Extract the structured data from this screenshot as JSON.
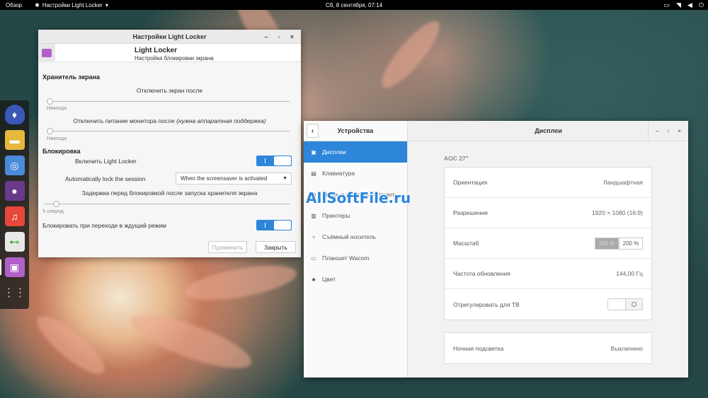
{
  "topbar": {
    "overview": "Обзор",
    "app_name": "Настройки Light Locker",
    "clock": "Сб, 8 сентября, 07:14",
    "tray_icons": [
      "display-icon",
      "wifi-icon",
      "volume-icon",
      "power-icon"
    ]
  },
  "dock": {
    "items": [
      "diamond-app-icon",
      "files-icon",
      "chromium-icon",
      "pidgin-icon",
      "music-icon",
      "settings-toggle-icon",
      "light-locker-icon",
      "app-grid-icon"
    ]
  },
  "light_locker": {
    "window_title": "Настройки Light Locker",
    "header_title": "Light Locker",
    "header_subtitle": "Настройка блокировки экрана",
    "screensaver_section": "Хранитель экрана",
    "screen_off_label": "Отключить экран после",
    "screen_off_value": "Никогда",
    "monitor_off_label": "Отключить питание монитора после",
    "monitor_off_hint": "(нужна аппаратная поддержка)",
    "monitor_off_value": "Никогда",
    "lock_section": "Блокировка",
    "enable_label": "Включить Light Locker",
    "enable_state": true,
    "auto_lock_label": "Automatically lock the session",
    "auto_lock_value": "When the screensaver is activated",
    "delay_label": "Задержка перед блокировкой после запуска хранителя экрана",
    "delay_value": "5 секунд",
    "delay_fraction": 0.05,
    "sleep_lock_label": "Блокировать при переходе в ждущий режим",
    "sleep_lock_state": true,
    "apply_button": "Применить",
    "close_button": "Закрыть"
  },
  "settings": {
    "left_title": "Устройства",
    "right_title": "Дисплеи",
    "nav": [
      {
        "label": "Дисплеи",
        "icon": "display-icon",
        "active": true
      },
      {
        "label": "Клавиатура",
        "icon": "keyboard-icon",
        "active": false
      },
      {
        "label": "Мышь и сенсорная панель",
        "icon": "mouse-icon",
        "active": false
      },
      {
        "label": "Принтеры",
        "icon": "printer-icon",
        "active": false
      },
      {
        "label": "Съёмный носитель",
        "icon": "usb-icon",
        "active": false
      },
      {
        "label": "Планшет Wacom",
        "icon": "tablet-icon",
        "active": false
      },
      {
        "label": "Цвет",
        "icon": "color-icon",
        "active": false
      }
    ],
    "monitor_name": "AOC 27\"",
    "rows": {
      "orientation_label": "Ориентация",
      "orientation_value": "Ландшафтная",
      "resolution_label": "Разрешение",
      "resolution_value": "1920 × 1080 (16:9)",
      "scale_label": "Масштаб",
      "scale_100": "100 %",
      "scale_200": "200 %",
      "refresh_label": "Частота обновления",
      "refresh_value": "144,00 Гц",
      "tv_label": "Отрегулировать для ТВ",
      "tv_state": false
    },
    "night_label": "Ночная подсветка",
    "night_value": "Выключено"
  },
  "watermark": "AllSoftFile.ru",
  "colors": {
    "accent": "#2d86d9",
    "topbar": "#000000"
  }
}
